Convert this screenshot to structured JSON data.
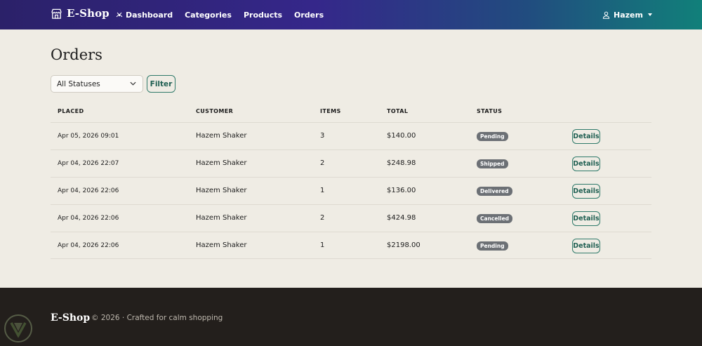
{
  "navbar": {
    "brand": "E-Shop",
    "links": [
      {
        "label": "Dashboard",
        "icon": "dashboard-icon"
      },
      {
        "label": "Categories"
      },
      {
        "label": "Products"
      },
      {
        "label": "Orders"
      }
    ],
    "user": {
      "name": "Hazem",
      "icon": "user-icon"
    }
  },
  "page": {
    "title": "Orders",
    "filter": {
      "select_value": "All Statuses",
      "button_label": "Filter"
    }
  },
  "table": {
    "headers": [
      "PLACED",
      "CUSTOMER",
      "ITEMS",
      "TOTAL",
      "STATUS",
      ""
    ],
    "rows": [
      {
        "placed": "Apr 05, 2026 09:01",
        "customer": "Hazem Shaker",
        "items": "3",
        "total": "$140.00",
        "status": "Pending",
        "action": "Details"
      },
      {
        "placed": "Apr 04, 2026 22:07",
        "customer": "Hazem Shaker",
        "items": "2",
        "total": "$248.98",
        "status": "Shipped",
        "action": "Details"
      },
      {
        "placed": "Apr 04, 2026 22:06",
        "customer": "Hazem Shaker",
        "items": "1",
        "total": "$136.00",
        "status": "Delivered",
        "action": "Details"
      },
      {
        "placed": "Apr 04, 2026 22:06",
        "customer": "Hazem Shaker",
        "items": "2",
        "total": "$424.98",
        "status": "Cancelled",
        "action": "Details"
      },
      {
        "placed": "Apr 04, 2026 22:06",
        "customer": "Hazem Shaker",
        "items": "1",
        "total": "$2198.00",
        "status": "Pending",
        "action": "Details"
      }
    ]
  },
  "footer": {
    "brand": "E-Shop",
    "text": "© 2026 · Crafted for calm shopping"
  },
  "colors": {
    "accent": "#2f7a6a",
    "badge": "#6c7075",
    "footer_bg": "#231f1c",
    "page_bg": "#efece4"
  }
}
